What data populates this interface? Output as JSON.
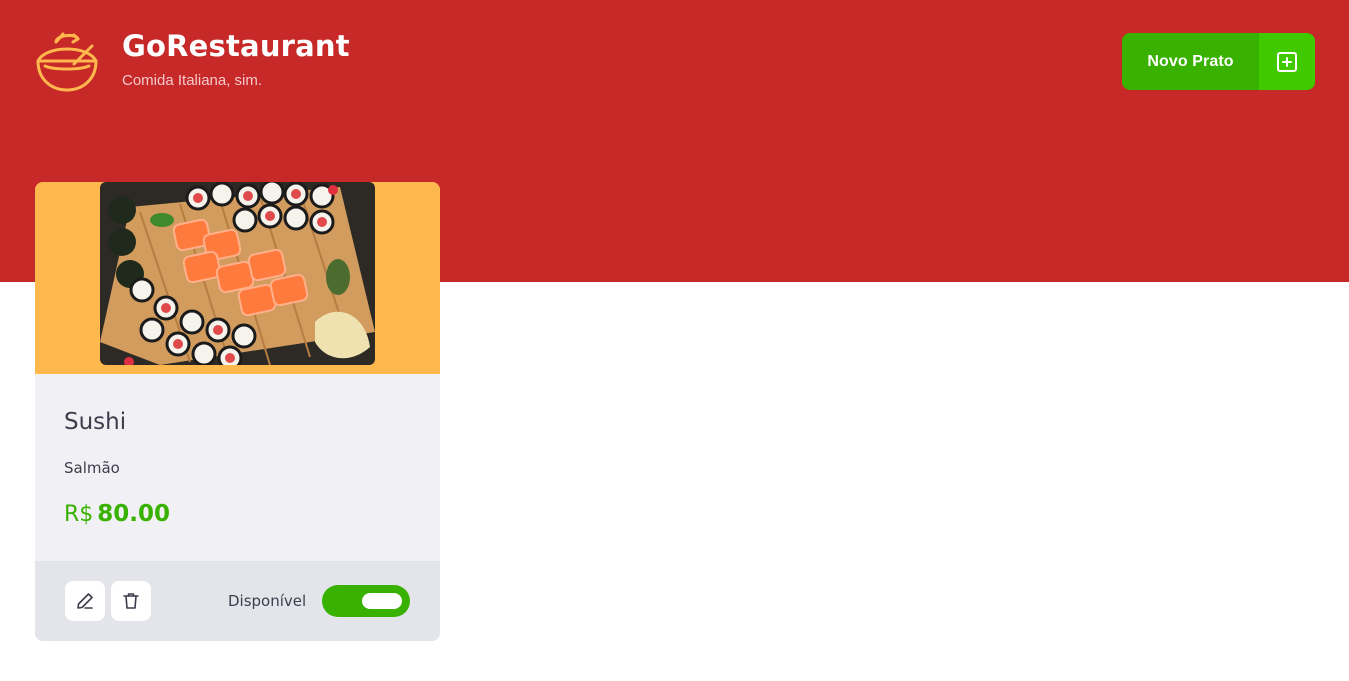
{
  "header": {
    "brand_title": "GoRestaurant",
    "brand_subtitle": "Comida Italiana, sim.",
    "logo_icon": "food-bowl-icon",
    "new_dish_label": "Novo Prato",
    "new_dish_icon": "plus-square-icon"
  },
  "dish": {
    "name": "Sushi",
    "description": "Salmão",
    "currency": "R$",
    "price": "80.00",
    "availability_label": "Disponível",
    "available": true,
    "image_alt": "sushi-platter"
  },
  "colors": {
    "header_bg": "#c72828",
    "accent_green": "#39b100",
    "accent_green_light": "#41c900",
    "image_bg": "#ffb84d",
    "card_bg": "#f0f0f5",
    "card_footer_bg": "#e4e4eb",
    "text_dark": "#3d3d4d",
    "logo_color": "#ffb84d"
  }
}
